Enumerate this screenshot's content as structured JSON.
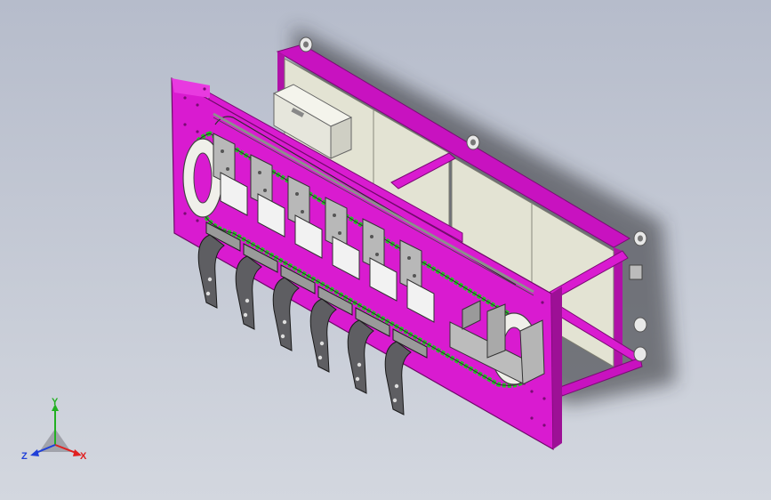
{
  "viewport": {
    "background": "#c4c9d4",
    "frame_color": "#d91bd0",
    "frame_dark": "#9d1096",
    "panel_color": "#e4e4d4"
  },
  "triad": {
    "x_label": "X",
    "y_label": "Y",
    "z_label": "Z",
    "x_color": "#e02020",
    "y_color": "#22b022",
    "z_color": "#2040d8"
  },
  "model": {
    "gripper_count": 6
  }
}
